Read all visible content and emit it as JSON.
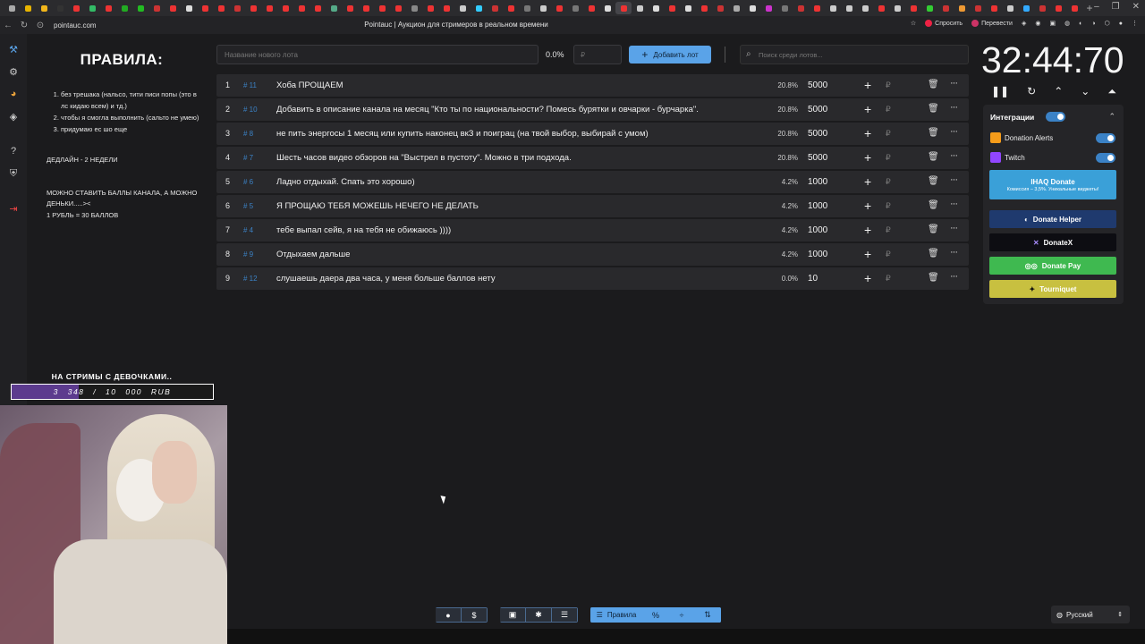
{
  "browser": {
    "url": "pointauc.com",
    "page_title": "Pointauc | Аукцион для стримеров в реальном времени",
    "ask_label": "Спросить",
    "translate_label": "Перевести",
    "tab_colors": [
      "#aaaaaa",
      "#e8b400",
      "#f2b61b",
      "#333333",
      "#e33",
      "#3b6",
      "#e33",
      "#2a2",
      "#2b2",
      "#c33",
      "#e33",
      "#ddd",
      "#e33",
      "#e33",
      "#c33",
      "#e33",
      "#e33",
      "#e33",
      "#e33",
      "#e33",
      "#5a8",
      "#e33",
      "#e33",
      "#e33",
      "#e33",
      "#888",
      "#e33",
      "#e33",
      "#ccc",
      "#3cf",
      "#c33",
      "#e33",
      "#777",
      "#ccc",
      "#e33",
      "#777",
      "#e33",
      "#ddd",
      "#e33",
      "#ccc",
      "#ddd",
      "#e33",
      "#ddd",
      "#e33",
      "#c33",
      "#aaa",
      "#ddd",
      "#c3c",
      "#777",
      "#c33",
      "#e33",
      "#ccc",
      "#ccc",
      "#ccc",
      "#e33",
      "#ccc",
      "#e33",
      "#3c3",
      "#c33",
      "#e93",
      "#c33",
      "#e33",
      "#ccc",
      "#3af",
      "#c33",
      "#e33",
      "#e33"
    ]
  },
  "rules": {
    "title": "ПРАВИЛА:",
    "items": [
      "без трешака (нальсо, тити писи попы (это в лс кидаю всем) и тд.)",
      "чтобы я смогла выполнить (сальто не умею)",
      "придумаю ес шо еще"
    ],
    "deadline": "ДЕДЛАЙН - 2 НЕДЕЛИ",
    "money_line1": "МОЖНО СТАВИТЬ БАЛЛЫ КАНАЛА, А МОЖНО ДЕНЬКИ.....><",
    "money_line2": "1 РУБЛЬ = 30 БАЛЛОВ"
  },
  "goal": {
    "title": "НА СТРИМЫ С ДЕВОЧКАМИ..",
    "current": "3 348",
    "separator": "/",
    "target": "10 000",
    "currency": "RUB",
    "progress_fraction": 0.3348
  },
  "toolbar": {
    "lot_placeholder": "Название нового лота",
    "percent": "0.0%",
    "amount_placeholder": "₽",
    "add_label": "Добавить лот",
    "search_placeholder": "Поиск среди лотов..."
  },
  "lots": [
    {
      "idx": "1",
      "fid": "# 11",
      "name": "Хоба ПРОЩАЕМ",
      "pct": "20.8%",
      "amount": "5000"
    },
    {
      "idx": "2",
      "fid": "# 10",
      "name": "Добавить в описание канала на месяц \"Кто ты по национальности? Помесь бурятки и овчарки - бурчарка\".",
      "pct": "20.8%",
      "amount": "5000"
    },
    {
      "idx": "3",
      "fid": "# 8",
      "name": "не пить энергосы 1 месяц или купить наконец вкЗ и поиграц (на твой выбор, выбирай с умом)",
      "pct": "20.8%",
      "amount": "5000"
    },
    {
      "idx": "4",
      "fid": "# 7",
      "name": "Шесть часов видео обзоров на \"Выстрел в пустоту\". Можно в три подхода.",
      "pct": "20.8%",
      "amount": "5000"
    },
    {
      "idx": "5",
      "fid": "# 6",
      "name": "Ладно отдыхай. Спать это хорошо)",
      "pct": "4.2%",
      "amount": "1000"
    },
    {
      "idx": "6",
      "fid": "# 5",
      "name": "Я ПРОЩАЮ ТЕБЯ МОЖЕШЬ НЕЧЕГО НЕ ДЕЛАТЬ",
      "pct": "4.2%",
      "amount": "1000"
    },
    {
      "idx": "7",
      "fid": "# 4",
      "name": "тебе выпал сейв, я на тебя не обижаюсь ))))",
      "pct": "4.2%",
      "amount": "1000"
    },
    {
      "idx": "8",
      "fid": "# 9",
      "name": "Отдыхаем дальше",
      "pct": "4.2%",
      "amount": "1000"
    },
    {
      "idx": "9",
      "fid": "# 12",
      "name": "слушаешь даера два часа, у меня больше баллов нету",
      "pct": "0.0%",
      "amount": "10"
    }
  ],
  "lot_icons": {
    "plus": "+",
    "currency": "₽",
    "trash": "🗑",
    "more": "···"
  },
  "timer": {
    "value": "32:44:70"
  },
  "integrations": {
    "title": "Интеграции",
    "donation_alerts": "Donation Alerts",
    "twitch": "Twitch",
    "ihaq_title": "IHAQ Donate",
    "ihaq_sub": "Комиссия – 3,5%. Уникальные виджеты!",
    "donate_helper": "Donate Helper",
    "donatex": "DonateX",
    "donate_pay": "Donate Pay",
    "tourniquet": "Tourniquet"
  },
  "bottom": {
    "rules_label": "Правила",
    "language": "Русский"
  },
  "colors": {
    "accent": "#5aa3e8",
    "lot_id": "#3b82c6",
    "goal_fill": "#5c3b8e",
    "donate_pay": "#3fb950",
    "tourniquet": "#c8c040",
    "ihaq": "#3aa0d8",
    "donate_helper": "#1f3a6e"
  }
}
